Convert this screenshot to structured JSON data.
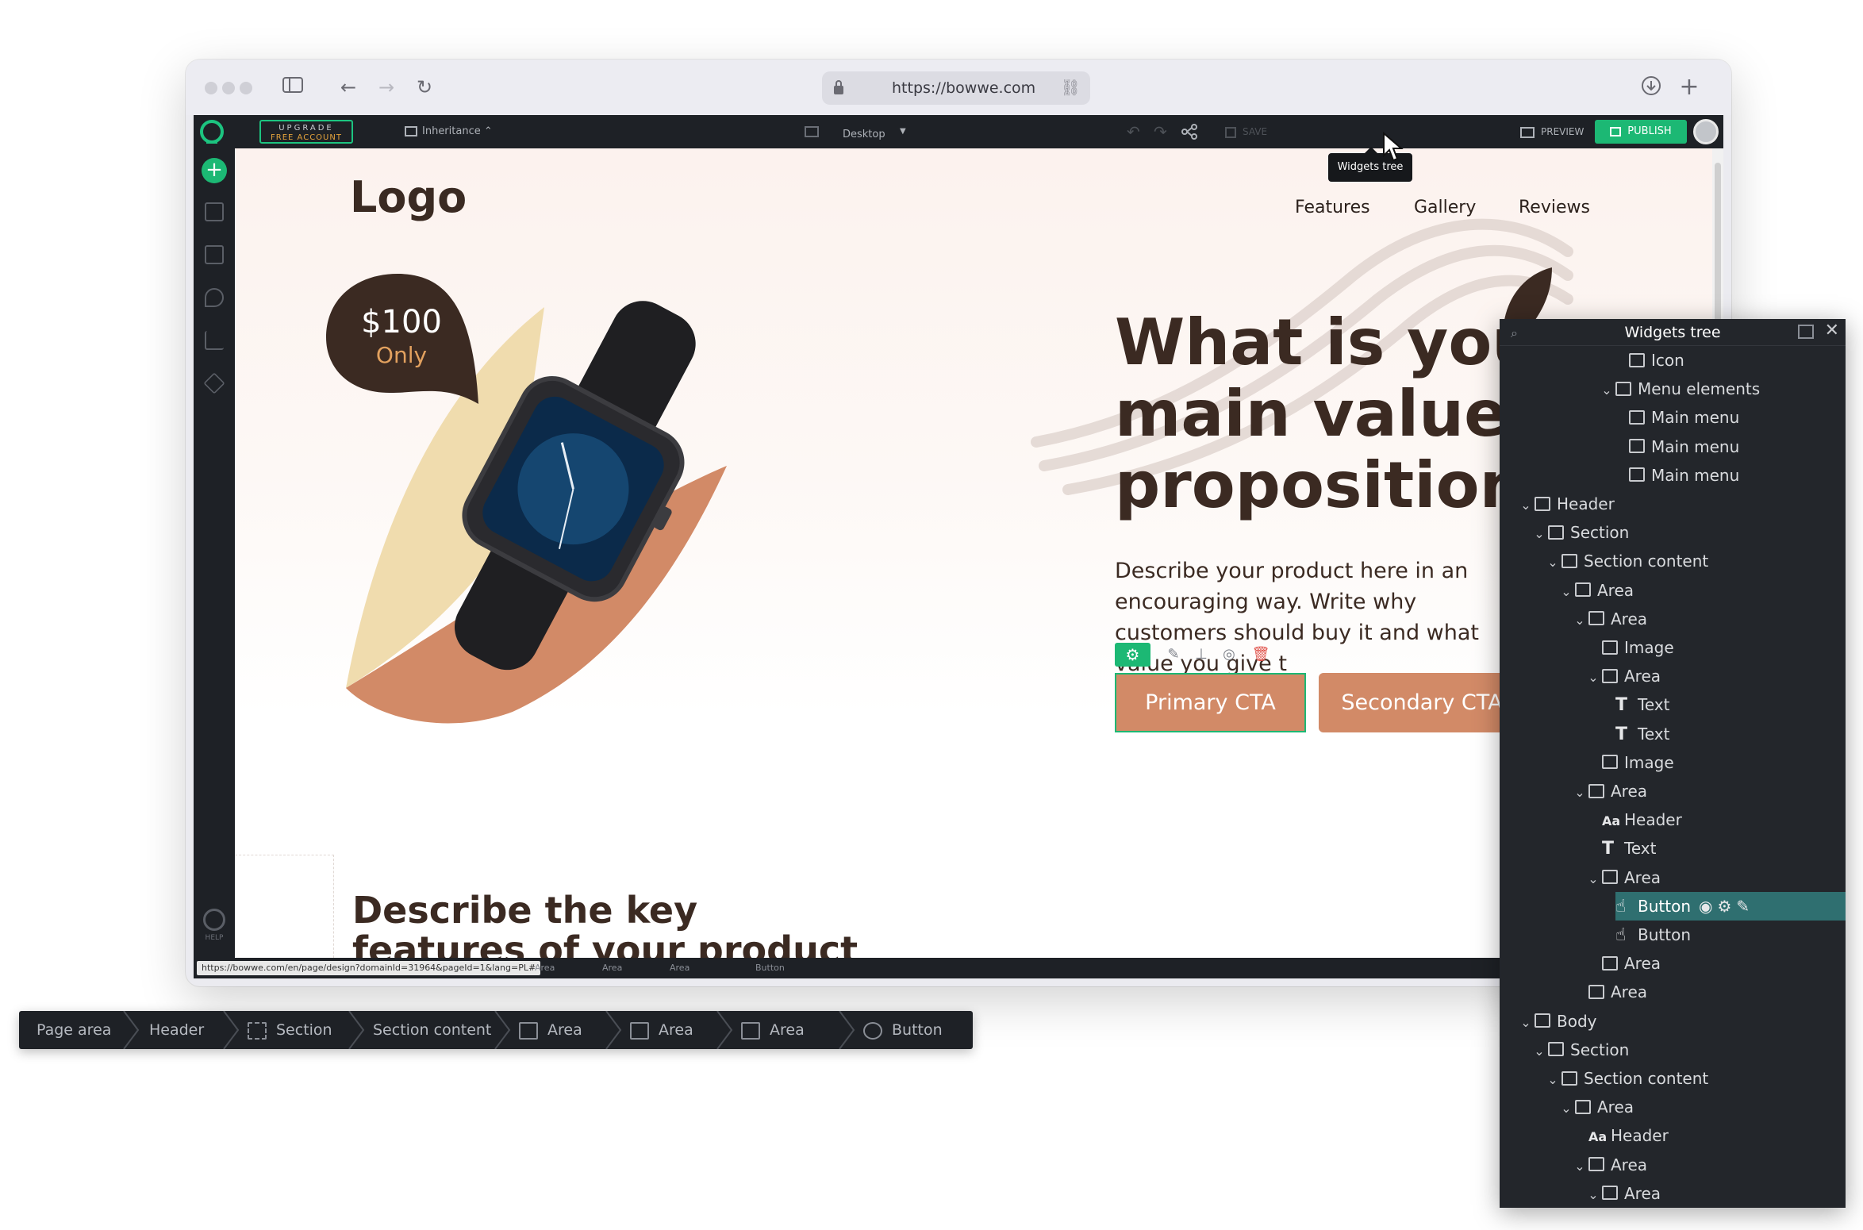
{
  "browser": {
    "url": "https://bowwe.com"
  },
  "editor": {
    "upgrade_line1": "UPGRADE",
    "upgrade_line2": "FREE ACCOUNT",
    "inheritance_label": "Inheritance",
    "device_label": "Desktop",
    "save_label": "SAVE",
    "preview_label": "PREVIEW",
    "publish_label": "PUBLISH",
    "tooltip": "Widgets tree",
    "help_label": "HELP"
  },
  "site": {
    "logo": "Logo",
    "nav": [
      "Features",
      "Gallery",
      "Reviews"
    ],
    "headline": "What is your main value proposition?",
    "description": "Describe your product here in an encouraging way. Write why customers should buy it and what value you give t",
    "price": "$100",
    "price_sub": "Only",
    "primary_cta": "Primary CTA",
    "secondary_cta": "Secondary CTA",
    "features_heading": "Describe the key features of your product"
  },
  "status_bar": {
    "url": "https://bowwe.com/en/page/design?domainId=31964&pageId=1&lang=PL#",
    "crumbs": [
      "Area",
      "Area",
      "Area",
      "Button"
    ]
  },
  "breadcrumb": [
    "Page area",
    "Header",
    "Section",
    "Section content",
    "Area",
    "Area",
    "Area",
    "Button"
  ],
  "widgets_tree": {
    "title": "Widgets tree",
    "rows": [
      {
        "label": "Icon",
        "depth": 8,
        "chev": false,
        "icon": "node"
      },
      {
        "label": "Menu elements",
        "depth": 7,
        "chev": true,
        "icon": "node"
      },
      {
        "label": "Main menu",
        "depth": 8,
        "chev": false,
        "icon": "node"
      },
      {
        "label": "Main menu",
        "depth": 8,
        "chev": false,
        "icon": "node"
      },
      {
        "label": "Main menu",
        "depth": 8,
        "chev": false,
        "icon": "node"
      },
      {
        "label": "Header",
        "depth": 1,
        "chev": true,
        "icon": "node"
      },
      {
        "label": "Section",
        "depth": 2,
        "chev": true,
        "icon": "node"
      },
      {
        "label": "Section content",
        "depth": 3,
        "chev": true,
        "icon": "node"
      },
      {
        "label": "Area",
        "depth": 4,
        "chev": true,
        "icon": "node"
      },
      {
        "label": "Area",
        "depth": 5,
        "chev": true,
        "icon": "node"
      },
      {
        "label": "Image",
        "depth": 6,
        "chev": false,
        "icon": "image"
      },
      {
        "label": "Area",
        "depth": 6,
        "chev": true,
        "icon": "node"
      },
      {
        "label": "Text",
        "depth": 7,
        "chev": false,
        "icon": "text"
      },
      {
        "label": "Text",
        "depth": 7,
        "chev": false,
        "icon": "text"
      },
      {
        "label": "Image",
        "depth": 6,
        "chev": false,
        "icon": "image"
      },
      {
        "label": "Area",
        "depth": 5,
        "chev": true,
        "icon": "node"
      },
      {
        "label": "Header",
        "depth": 6,
        "chev": false,
        "icon": "heading"
      },
      {
        "label": "Text",
        "depth": 6,
        "chev": false,
        "icon": "text"
      },
      {
        "label": "Area",
        "depth": 6,
        "chev": true,
        "icon": "node"
      },
      {
        "label": "Button",
        "depth": 7,
        "chev": false,
        "icon": "button",
        "selected": true
      },
      {
        "label": "Button",
        "depth": 7,
        "chev": false,
        "icon": "button"
      },
      {
        "label": "Area",
        "depth": 6,
        "chev": false,
        "icon": "node"
      },
      {
        "label": "Area",
        "depth": 5,
        "chev": false,
        "icon": "node"
      },
      {
        "label": "Body",
        "depth": 1,
        "chev": true,
        "icon": "node"
      },
      {
        "label": "Section",
        "depth": 2,
        "chev": true,
        "icon": "node"
      },
      {
        "label": "Section content",
        "depth": 3,
        "chev": true,
        "icon": "node"
      },
      {
        "label": "Area",
        "depth": 4,
        "chev": true,
        "icon": "node"
      },
      {
        "label": "Header",
        "depth": 5,
        "chev": false,
        "icon": "heading"
      },
      {
        "label": "Area",
        "depth": 5,
        "chev": true,
        "icon": "node"
      },
      {
        "label": "Area",
        "depth": 6,
        "chev": true,
        "icon": "node"
      }
    ]
  },
  "colors": {
    "accent": "#1cb874",
    "cta": "#d28a67",
    "headline": "#3b2a22",
    "tree_selected": "#2f6f70"
  }
}
